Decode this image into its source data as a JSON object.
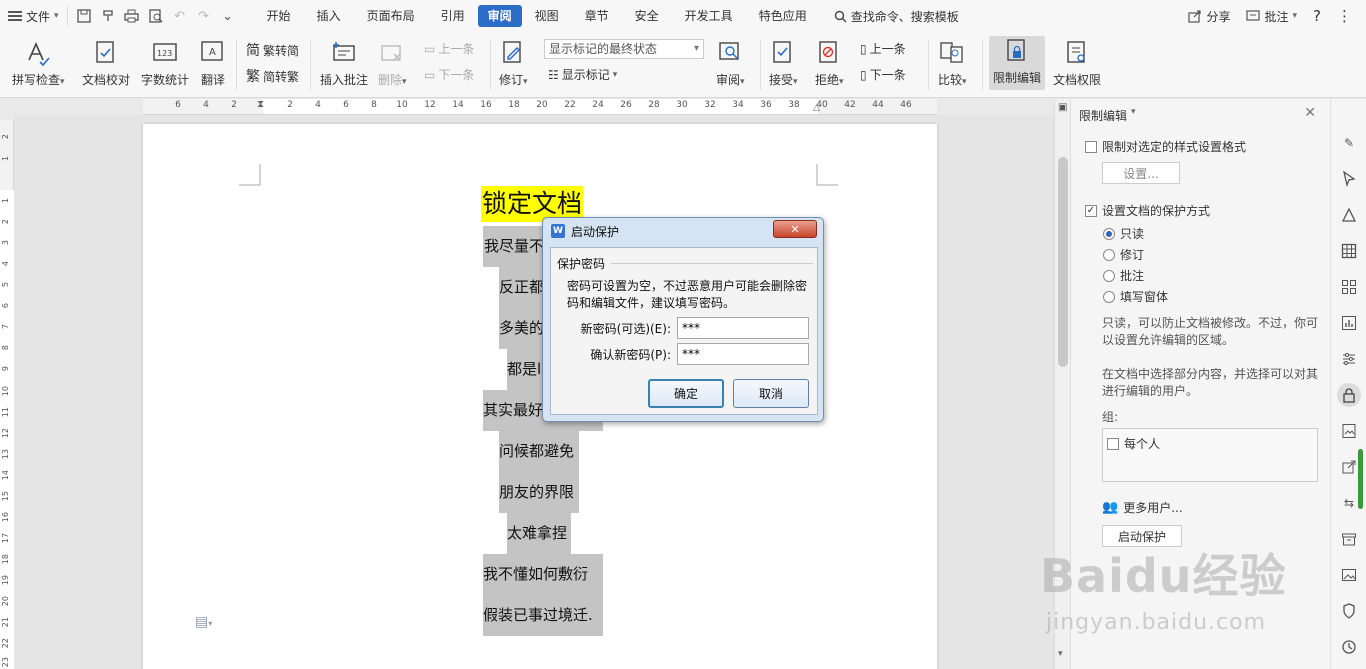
{
  "menubar": {
    "file_label": "文件",
    "tabs": [
      "开始",
      "插入",
      "页面布局",
      "引用",
      "审阅",
      "视图",
      "章节",
      "安全",
      "开发工具",
      "特色应用"
    ],
    "active_tab": "审阅",
    "search_label": "查找命令、搜索模板",
    "share_label": "分享",
    "comment_label": "批注",
    "help_label": "?"
  },
  "ribbon": {
    "spell_check": "拼写检查",
    "doc_proof": "文档校对",
    "word_count": "字数统计",
    "translate": "翻译",
    "to_traditional": "繁转简",
    "to_simplified": "简转繁",
    "insert_comment": "插入批注",
    "delete": "删除",
    "prev": "上一条",
    "next": "下一条",
    "track_changes": "修订",
    "markup_combo": "显示标记的最终状态",
    "show_markup": "显示标记",
    "review": "审阅",
    "accept": "接受",
    "reject": "拒绝",
    "prev2": "上一条",
    "next2": "下一条",
    "compare": "比较",
    "restrict_edit": "限制编辑",
    "doc_permission": "文档权限"
  },
  "ruler": {
    "h_numbers": [
      "6",
      "4",
      "2",
      "2",
      "4",
      "6",
      "8",
      "10",
      "12",
      "14",
      "16",
      "18",
      "20",
      "22",
      "24",
      "26",
      "28",
      "30",
      "32",
      "34",
      "36",
      "38",
      "40",
      "42",
      "44",
      "46"
    ],
    "v_numbers": [
      "2",
      "1",
      "1",
      "2",
      "3",
      "4",
      "5",
      "6",
      "7",
      "8",
      "9",
      "10",
      "11",
      "12",
      "13",
      "14",
      "15",
      "16",
      "17",
      "18",
      "19",
      "20",
      "21",
      "22",
      "23"
    ]
  },
  "document": {
    "title": "锁定文档",
    "lines": [
      "我尽量不",
      "反正都",
      "多美的",
      "都是la",
      "其实最好",
      "问候都避免",
      "朋友的界限",
      "太难拿捏",
      "我不懂如何敷衍",
      "假装已事过境迁."
    ]
  },
  "dialog": {
    "title": "启动保护",
    "close": "✕",
    "group_label": "保护密码",
    "hint": "密码可设置为空，不过恶意用户可能会删除密码和编辑文件，建议填写密码。",
    "new_pwd_label": "新密码(可选)(E):",
    "new_pwd_value": "***",
    "confirm_pwd_label": "确认新密码(P):",
    "confirm_pwd_value": "***",
    "ok": "确定",
    "cancel": "取消"
  },
  "panel": {
    "title": "限制编辑",
    "opt1": "限制对选定的样式设置格式",
    "settings_btn": "设置...",
    "opt2": "设置文档的保护方式",
    "radios": [
      "只读",
      "修订",
      "批注",
      "填写窗体"
    ],
    "desc1": "只读，可以防止文档被修改。不过，你可以设置允许编辑的区域。",
    "desc2": "在文档中选择部分内容，并选择可以对其进行编辑的用户。",
    "group_label": "组:",
    "everyone": "每个人",
    "more_users": "更多用户...",
    "start_protect": "启动保护"
  },
  "watermark": {
    "brand": "Baidu经验",
    "url": "jingyan.baidu.com"
  }
}
